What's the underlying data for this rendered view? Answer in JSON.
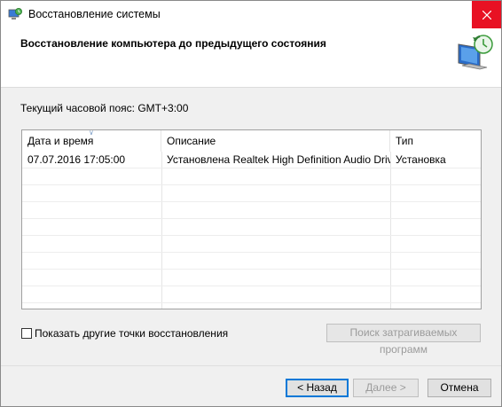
{
  "window": {
    "title": "Восстановление системы",
    "close_icon": "close-icon",
    "accent_close": "#e81123"
  },
  "header": {
    "title": "Восстановление компьютера до предыдущего состояния",
    "icon": "system-restore-icon"
  },
  "timezone_text": "Текущий часовой пояс: GMT+3:00",
  "table": {
    "columns": [
      "Дата и время",
      "Описание",
      "Тип"
    ],
    "rows": [
      [
        "07.07.2016 17:05:00",
        "Установлена Realtek High Definition Audio Driver",
        "Установка"
      ]
    ]
  },
  "show_more_label": "Показать другие точки восстановления",
  "buttons": {
    "scan": "Поиск затрагиваемых программ",
    "back": "< Назад",
    "next": "Далее >",
    "cancel": "Отмена"
  }
}
